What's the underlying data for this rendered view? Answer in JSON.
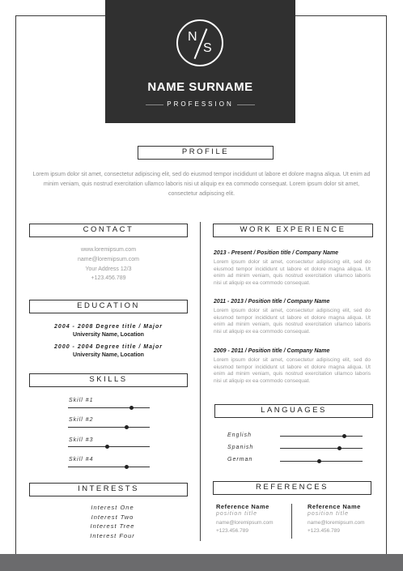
{
  "header": {
    "monogram_left": "N",
    "monogram_right": "S",
    "name": "NAME SURNAME",
    "profession": "PROFESSION"
  },
  "profile": {
    "title": "PROFILE",
    "text": "Lorem ipsum dolor sit amet, consectetur adipiscing elit, sed do eiusmod tempor incididunt ut labore et dolore magna aliqua. Ut enim ad minim veniam, quis nostrud exercitation ullamco laboris nisi ut aliquip ex ea commodo consequat.  Lorem ipsum dolor sit amet, consectetur adipiscing elit."
  },
  "contact": {
    "title": "CONTACT",
    "lines": [
      "www.loremipsum.com",
      "name@loremipsum.com",
      "Your Address 12/3",
      "+123.456.789"
    ]
  },
  "education": {
    "title": "EDUCATION",
    "items": [
      {
        "degree": "2004 - 2008 Degree title / Major",
        "school": "University Name, Location"
      },
      {
        "degree": "2000 - 2004 Degree title / Major",
        "school": "University Name, Location"
      }
    ]
  },
  "skills": {
    "title": "SKILLS",
    "items": [
      {
        "label": "Skill #1",
        "level": 0.78
      },
      {
        "label": "Skill #2",
        "level": 0.72
      },
      {
        "label": "Skill #3",
        "level": 0.48
      },
      {
        "label": "Skill #4",
        "level": 0.72
      }
    ]
  },
  "interests": {
    "title": "INTERESTS",
    "items": [
      "Interest One",
      "Interest Two",
      "Interest Tree",
      "Interest Four"
    ]
  },
  "work": {
    "title": "WORK EXPERIENCE",
    "items": [
      {
        "title": "2013 - Present / Position title / Company Name",
        "desc": "Lorem ipsum dolor sit amet, consectetur adipiscing elit, sed do eiusmod tempor incididunt ut labore et dolore magna aliqua. Ut enim ad minim veniam, quis nostrud exercitation ullamco laboris nisi ut aliquip ex ea commodo consequat."
      },
      {
        "title": "2011 - 2013 / Position title / Company Name",
        "desc": "Lorem ipsum dolor sit amet, consectetur adipiscing elit, sed do eiusmod tempor incididunt ut labore et dolore magna aliqua. Ut enim ad minim veniam, quis nostrud exercitation ullamco laboris nisi ut aliquip ex ea commodo consequat."
      },
      {
        "title": "2009 - 2011 / Position title / Company Name",
        "desc": "Lorem ipsum dolor sit amet, consectetur adipiscing elit, sed do eiusmod tempor incididunt ut labore et dolore magna aliqua. Ut enim ad minim veniam, quis nostrud exercitation ullamco laboris nisi ut aliquip ex ea commodo consequat."
      }
    ]
  },
  "languages": {
    "title": "LANGUAGES",
    "items": [
      {
        "label": "English",
        "level": 0.78
      },
      {
        "label": "Spanish",
        "level": 0.72
      },
      {
        "label": "German",
        "level": 0.48
      }
    ]
  },
  "references": {
    "title": "REFERENCES",
    "items": [
      {
        "name": "Reference Name",
        "position": "position title",
        "email": "name@loremipsum.com",
        "phone": "+123.456.789"
      },
      {
        "name": "Reference Name",
        "position": "position title",
        "email": "name@loremipsum.com",
        "phone": "+123.456.789"
      }
    ]
  }
}
